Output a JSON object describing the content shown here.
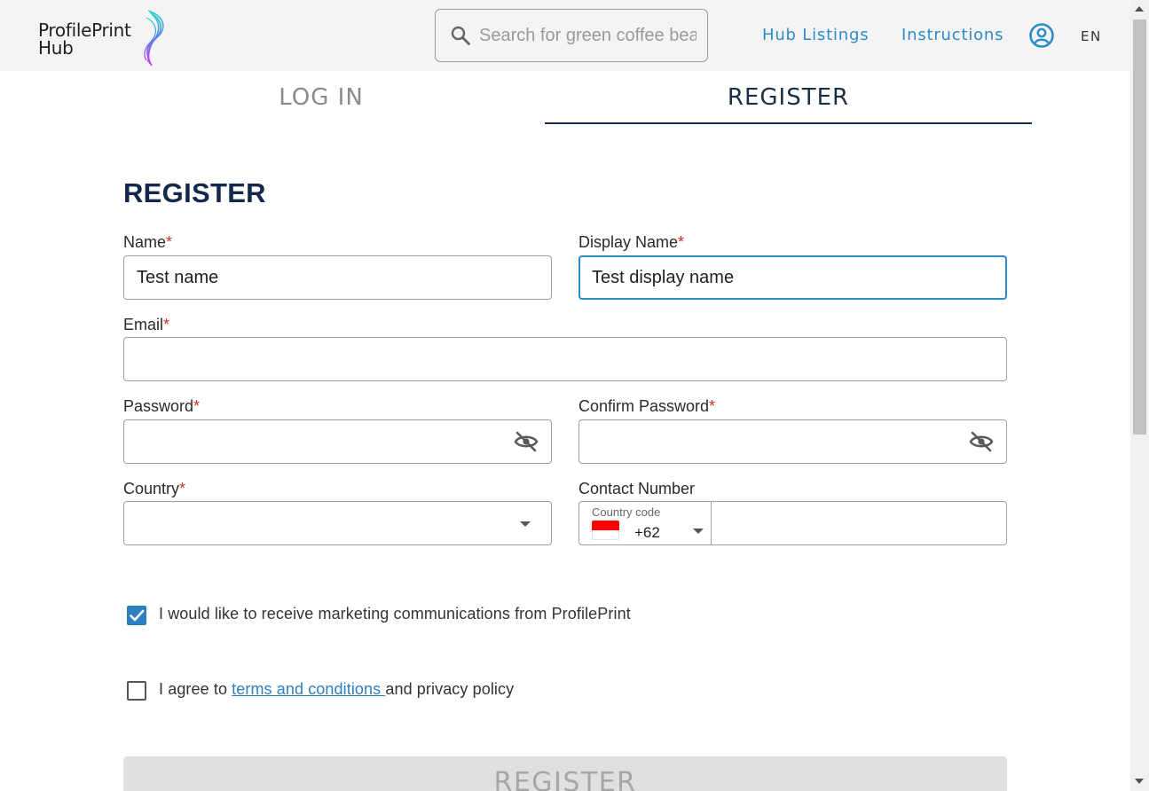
{
  "header": {
    "logo_line1": "ProfilePrint",
    "logo_line2": "Hub",
    "search_placeholder": "Search for green coffee beans",
    "nav": {
      "hub_listings": "Hub Listings",
      "instructions": "Instructions"
    },
    "language": "EN"
  },
  "tabs": {
    "login": "LOG IN",
    "register": "REGISTER",
    "active": "register"
  },
  "form": {
    "title": "REGISTER",
    "name": {
      "label": "Name",
      "required": "*",
      "value": "Test name"
    },
    "display_name": {
      "label": "Display Name",
      "required": "*",
      "value": "Test display name"
    },
    "email": {
      "label": "Email",
      "required": "*",
      "value": ""
    },
    "password": {
      "label": "Password",
      "required": "*",
      "value": ""
    },
    "confirm_password": {
      "label": "Confirm Password",
      "required": "*",
      "value": ""
    },
    "country": {
      "label": "Country",
      "required": "*",
      "value": ""
    },
    "contact": {
      "label": "Contact Number",
      "country_code_label": "Country code",
      "country_code_value": "+62",
      "flag": "indonesia-flag",
      "number": ""
    },
    "marketing": {
      "text": "I would like to receive marketing communications from ProfilePrint",
      "checked": true
    },
    "terms": {
      "prefix": "I agree to ",
      "link": "terms and conditions ",
      "suffix": "and privacy policy",
      "checked": false
    },
    "submit_label": "REGISTER"
  },
  "colors": {
    "accent": "#2d8bc9",
    "title": "#13284a",
    "required": "#d32f2f",
    "checkbox": "#2d7fc1"
  },
  "icons": [
    "search-icon",
    "user-account-icon",
    "eye-off-icon",
    "chevron-down-icon",
    "check-icon"
  ]
}
